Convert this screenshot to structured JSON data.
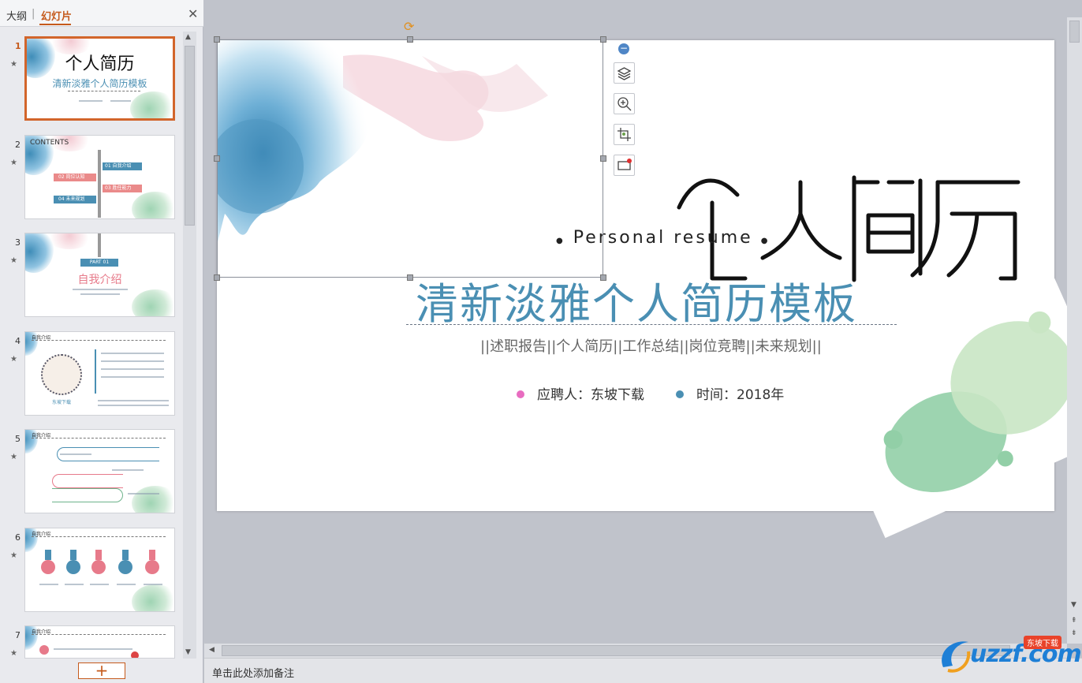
{
  "panel": {
    "tab_outline": "大纲",
    "tab_separator": "|",
    "tab_slides": "幻灯片",
    "close": "✕",
    "add_slide": "+"
  },
  "thumbnails": [
    {
      "num": "1",
      "title": "个人简历",
      "subtitle": "清新淡雅个人简历模板"
    },
    {
      "num": "2",
      "title": "CONTENTS",
      "items": [
        "01 自我介绍",
        "02 岗位认知",
        "03 胜任能力",
        "04 未来规划"
      ]
    },
    {
      "num": "3",
      "badge": "PART 01",
      "title": "自我介绍"
    },
    {
      "num": "4",
      "title": "自我介绍",
      "name": "东坡下载"
    },
    {
      "num": "5",
      "title": "自我介绍"
    },
    {
      "num": "6",
      "title": "自我介绍"
    },
    {
      "num": "7",
      "title": "自我介绍"
    }
  ],
  "slide": {
    "title_en": "Personal resume",
    "main_title": "清新淡雅个人简历模板",
    "tagline": "||述职报告||个人简历||工作总结||岗位竞聘||未来规划||",
    "applicant": "应聘人：东坡下载",
    "time": "时间：2018年",
    "colors": {
      "pink_dot": "#e86cc0",
      "blue_dot": "#4a8fb3",
      "title_blue": "#4a8fb3"
    }
  },
  "toolbar_icons": [
    "layers-icon",
    "zoom-in-icon",
    "crop-icon",
    "screen-record-icon"
  ],
  "notes": {
    "placeholder": "单击此处添加备注"
  },
  "watermark": {
    "text": "uzzf.com",
    "badge": "东坡下载"
  }
}
